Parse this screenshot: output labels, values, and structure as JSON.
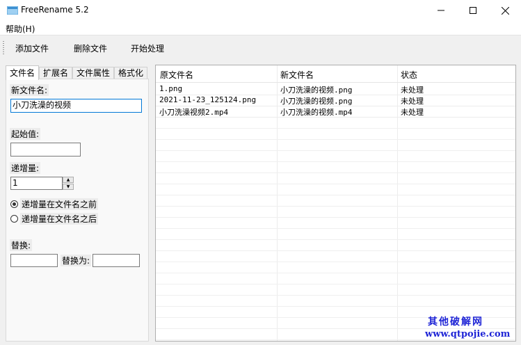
{
  "window": {
    "title": "FreeRename 5.2"
  },
  "menu": {
    "help": "帮助(H)"
  },
  "toolbar": {
    "add": "添加文件",
    "delete": "删除文件",
    "start": "开始处理"
  },
  "tabs": [
    "文件名",
    "扩展名",
    "文件属性",
    "格式化"
  ],
  "form": {
    "new_name_label": "新文件名:",
    "new_name_value": "小刀洗澡的视频",
    "start_label": "起始值:",
    "start_value": "",
    "step_label": "递增量:",
    "step_value": "1",
    "radio_before": "递增量在文件名之前",
    "radio_after": "递增量在文件名之后",
    "replace_label": "替换:",
    "replace_with_label": "替换为:",
    "replace_value": "",
    "replace_with_value": ""
  },
  "table": {
    "headers": [
      "原文件名",
      "新文件名",
      "状态"
    ],
    "rows": [
      [
        "1.png",
        "小刀洗澡的视频.png",
        "未处理"
      ],
      [
        "2021-11-23_125124.png",
        "小刀洗澡的视频.png",
        "未处理"
      ],
      [
        "小刀洗澡视频2.mp4",
        "小刀洗澡的视频.mp4",
        "未处理"
      ]
    ]
  },
  "watermark": {
    "line1": "其他破解网",
    "line2": "www.qtpojie.com"
  }
}
